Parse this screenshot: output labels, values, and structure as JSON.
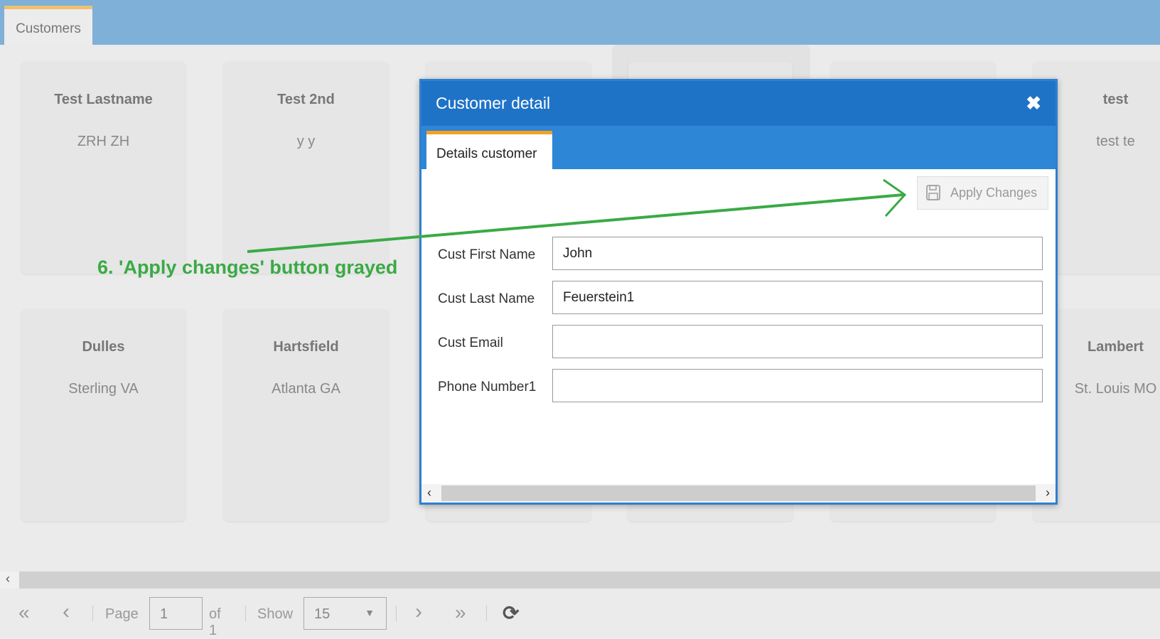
{
  "app": {
    "tab": "Customers"
  },
  "cards": [
    {
      "title": "Test Lastname",
      "subtitle": "ZRH ZH"
    },
    {
      "title": "Test 2nd",
      "subtitle": "y y"
    },
    {
      "title": "test",
      "subtitle": "test te"
    },
    {
      "title": "Dulles",
      "subtitle": "Sterling VA"
    },
    {
      "title": "Hartsfield",
      "subtitle": "Atlanta GA"
    },
    {
      "title": "Lambert",
      "subtitle": "St. Louis MO"
    }
  ],
  "modal": {
    "title": "Customer detail",
    "close": "✖",
    "tab": "Details customer",
    "apply": "Apply Changes",
    "fields": [
      {
        "label": "Cust First Name",
        "value": "John"
      },
      {
        "label": "Cust Last Name",
        "value": "Feuerstein1"
      },
      {
        "label": "Cust Email",
        "value": ""
      },
      {
        "label": "Phone Number1",
        "value": ""
      }
    ]
  },
  "pager": {
    "first": "«",
    "prev": "‹",
    "page_label": "Page",
    "page": "1",
    "of": "of 1",
    "show_label": "Show",
    "show": "15",
    "next": "›",
    "last": "»",
    "refresh": "⟳"
  },
  "annotation": {
    "text": "6. 'Apply changes' button grayed",
    "color": "#3aaa45"
  }
}
